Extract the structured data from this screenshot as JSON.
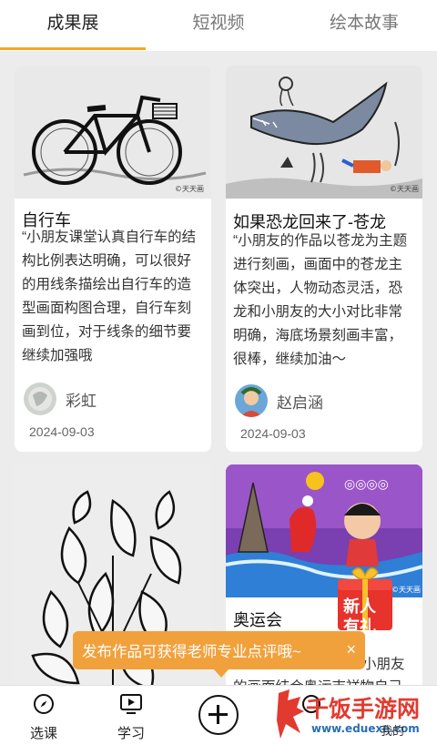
{
  "tabs": [
    {
      "label": "成果展",
      "active": true
    },
    {
      "label": "短视频",
      "active": false
    },
    {
      "label": "绘本故事",
      "active": false
    }
  ],
  "cards": [
    {
      "title": "自行车",
      "description": "“小朋友课堂认真自行车的结构比例表达明确，可以很好的用线条描绘出自行车的造型画面构图合理，自行车刻画到位，对于线条的细节要继续加强哦",
      "author": "彩虹",
      "date": "2024-09-03"
    },
    {
      "title": "如果恐龙回来了-苍龙",
      "description": "“小朋友的作品以苍龙为主题进行刻画，画面中的苍龙主体突出，人物动态灵活，恐龙和小朋友的大小对比非常明确，海底场景刻画丰富，很棒，继续加油～",
      "author": "赵启涵",
      "date": "2024-09-03"
    },
    {
      "title": "",
      "description": ""
    },
    {
      "title": "奥运会",
      "description_fragment": "小朋友",
      "description_partial": "的画面结合奥运吉祥物自己"
    }
  ],
  "promo_badge": {
    "line1": "新人",
    "line2": "有礼"
  },
  "toast": {
    "text": "发布作品可获得老师专业点评哦~",
    "close": "×"
  },
  "bottom_nav": [
    {
      "label": "选课",
      "icon": "compass-icon"
    },
    {
      "label": "学习",
      "icon": "play-screen-icon"
    },
    {
      "label": "",
      "icon": "plus-icon"
    },
    {
      "label": "",
      "icon": "community-icon"
    },
    {
      "label": "我的",
      "icon": "profile-icon"
    }
  ],
  "watermark": {
    "big": "千饭手游网",
    "small": "www.eduexe.com",
    "extra": "我的"
  },
  "colors": {
    "accent": "#f5a623",
    "toast": "#f1a13c",
    "watermark_red": "#e23a2f",
    "watermark_blue": "#2a6db5"
  }
}
